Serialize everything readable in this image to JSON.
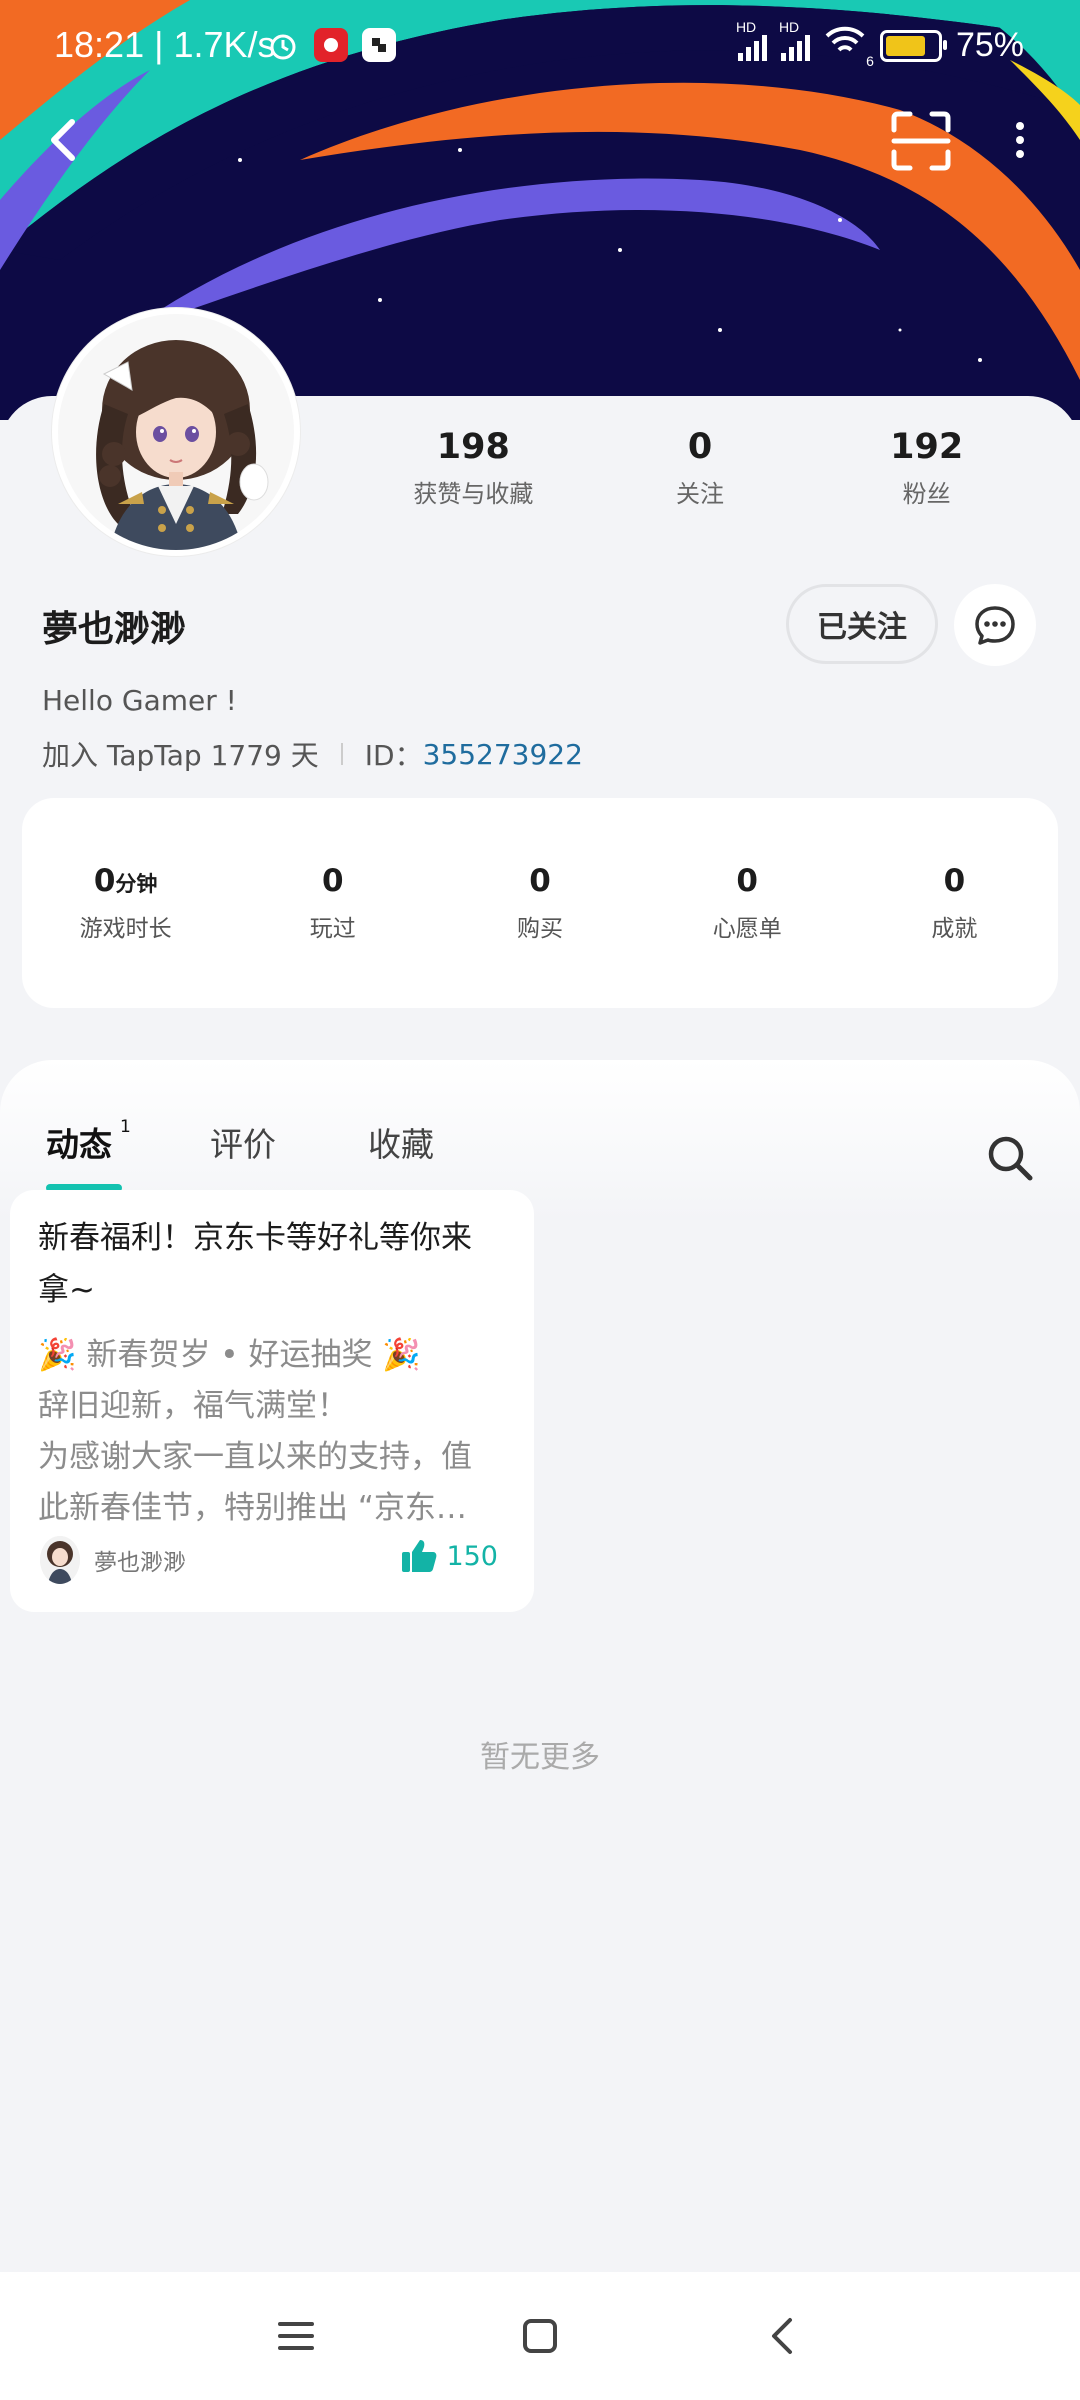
{
  "status_bar": {
    "time": "18:21",
    "speed": "1.7K/s",
    "battery": "75%",
    "hd1": "HD",
    "hd2": "HD",
    "wifi_badge": "6"
  },
  "nav": {
    "back_icon": "chevron-left-icon",
    "scan_icon": "scan-icon",
    "more_icon": "more-vertical-icon"
  },
  "profile": {
    "username": "夢也渺渺",
    "bio": "Hello Gamer !",
    "joined": "加入 TapTap 1779 天",
    "id_label": "ID：",
    "id_value": "355273922",
    "follow_button": "已关注",
    "stats": [
      {
        "value": "198",
        "label": "获赞与收藏"
      },
      {
        "value": "0",
        "label": "关注"
      },
      {
        "value": "192",
        "label": "粉丝"
      }
    ]
  },
  "game_stats": [
    {
      "value": "0",
      "unit": "分钟",
      "label": "游戏时长"
    },
    {
      "value": "0",
      "unit": "",
      "label": "玩过"
    },
    {
      "value": "0",
      "unit": "",
      "label": "购买"
    },
    {
      "value": "0",
      "unit": "",
      "label": "心愿单"
    },
    {
      "value": "0",
      "unit": "",
      "label": "成就"
    }
  ],
  "tabs": [
    {
      "label": "动态",
      "badge": "1",
      "active": true
    },
    {
      "label": "评价",
      "badge": "",
      "active": false
    },
    {
      "label": "收藏",
      "badge": "",
      "active": false
    }
  ],
  "post": {
    "title_line1": "新春福利！京东卡等好礼等你来",
    "title_line2": "拿~",
    "body_line1": "🎉 新春贺岁 • 好运抽奖 🎉",
    "body_line2": "辞旧迎新，福气满堂！",
    "body_line3": "为感谢大家一直以来的支持，值",
    "body_line4": "此新春佳节，特别推出 “京东…",
    "author": "夢也渺渺",
    "likes": "150"
  },
  "no_more": "暂无更多",
  "colors": {
    "accent": "#13c2b0",
    "id_blue": "#1f6c9e",
    "banner_navy": "#0d0a45",
    "banner_orange": "#f26a23",
    "banner_teal": "#19c9b4",
    "banner_purple": "#6a5be0",
    "banner_yellow": "#f5d21c"
  }
}
